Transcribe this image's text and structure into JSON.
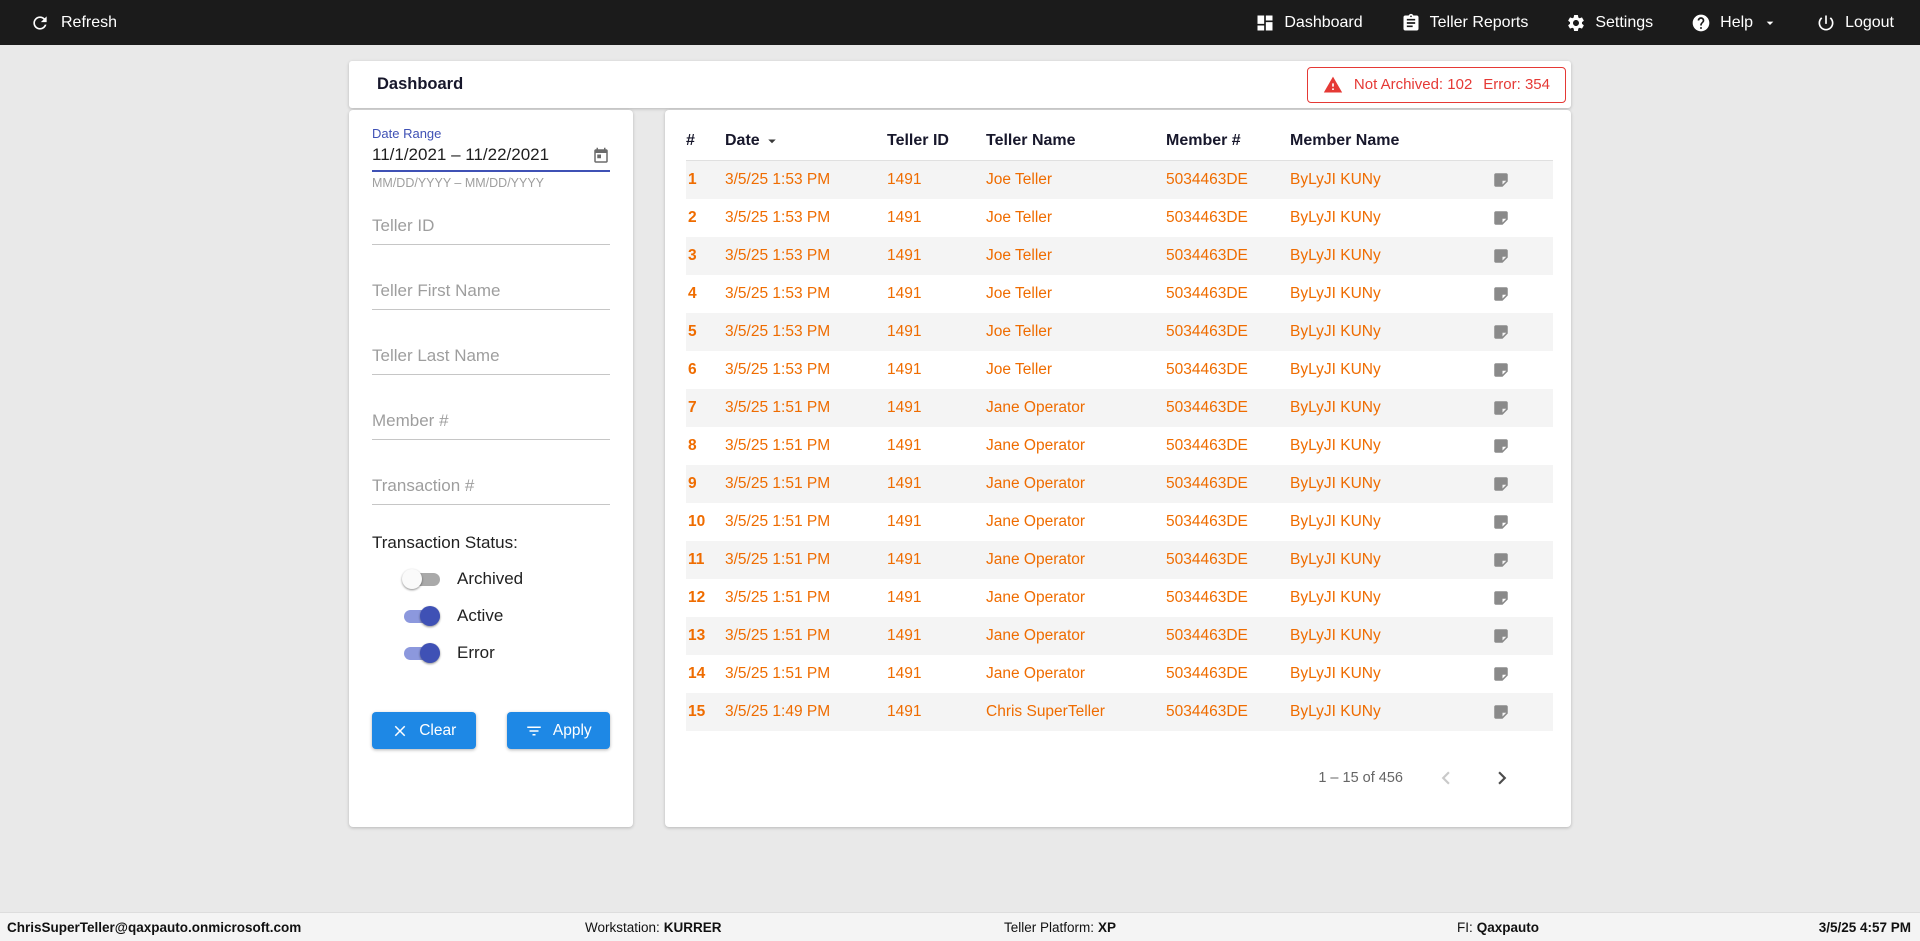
{
  "colors": {
    "accent_blue": "#1e88e5",
    "toggle_on": "#3f51b5",
    "row_text_orange": "#ef6c00",
    "alert_red": "#e53935",
    "topbar_bg": "#1b1b1b"
  },
  "topbar": {
    "refresh_label": "Refresh",
    "nav": [
      {
        "label": "Dashboard",
        "icon": "dashboard-icon"
      },
      {
        "label": "Teller Reports",
        "icon": "clipboard-icon"
      },
      {
        "label": "Settings",
        "icon": "gear-icon"
      },
      {
        "label": "Help",
        "icon": "help-icon"
      },
      {
        "label": "Logout",
        "icon": "power-icon"
      }
    ]
  },
  "header": {
    "title": "Dashboard",
    "alert": {
      "not_archived": "Not Archived: 102",
      "error": "Error: 354"
    }
  },
  "filters": {
    "date_range": {
      "label": "Date Range",
      "value": "11/1/2021 – 11/22/2021",
      "helper": "MM/DD/YYYY – MM/DD/YYYY"
    },
    "fields": [
      {
        "placeholder": "Teller ID"
      },
      {
        "placeholder": "Teller First Name"
      },
      {
        "placeholder": "Teller Last Name"
      },
      {
        "placeholder": "Member #"
      },
      {
        "placeholder": "Transaction #"
      }
    ],
    "status": {
      "label": "Transaction Status:",
      "toggles": [
        {
          "label": "Archived",
          "on": false
        },
        {
          "label": "Active",
          "on": true
        },
        {
          "label": "Error",
          "on": true
        }
      ]
    },
    "clear_label": "Clear",
    "apply_label": "Apply"
  },
  "table": {
    "columns": [
      "#",
      "Date",
      "Teller ID",
      "Teller Name",
      "Member #",
      "Member Name"
    ],
    "rows": [
      {
        "num": "1",
        "date": "3/5/25 1:53 PM",
        "teller_id": "1491",
        "teller_name": "Joe Teller",
        "member_num": "5034463DE",
        "member_name": "ByLyJI KUNy"
      },
      {
        "num": "2",
        "date": "3/5/25 1:53 PM",
        "teller_id": "1491",
        "teller_name": "Joe Teller",
        "member_num": "5034463DE",
        "member_name": "ByLyJI KUNy"
      },
      {
        "num": "3",
        "date": "3/5/25 1:53 PM",
        "teller_id": "1491",
        "teller_name": "Joe Teller",
        "member_num": "5034463DE",
        "member_name": "ByLyJI KUNy"
      },
      {
        "num": "4",
        "date": "3/5/25 1:53 PM",
        "teller_id": "1491",
        "teller_name": "Joe Teller",
        "member_num": "5034463DE",
        "member_name": "ByLyJI KUNy"
      },
      {
        "num": "5",
        "date": "3/5/25 1:53 PM",
        "teller_id": "1491",
        "teller_name": "Joe Teller",
        "member_num": "5034463DE",
        "member_name": "ByLyJI KUNy"
      },
      {
        "num": "6",
        "date": "3/5/25 1:53 PM",
        "teller_id": "1491",
        "teller_name": "Joe Teller",
        "member_num": "5034463DE",
        "member_name": "ByLyJI KUNy"
      },
      {
        "num": "7",
        "date": "3/5/25 1:51 PM",
        "teller_id": "1491",
        "teller_name": "Jane Operator",
        "member_num": "5034463DE",
        "member_name": "ByLyJI KUNy"
      },
      {
        "num": "8",
        "date": "3/5/25 1:51 PM",
        "teller_id": "1491",
        "teller_name": "Jane Operator",
        "member_num": "5034463DE",
        "member_name": "ByLyJI KUNy"
      },
      {
        "num": "9",
        "date": "3/5/25 1:51 PM",
        "teller_id": "1491",
        "teller_name": "Jane Operator",
        "member_num": "5034463DE",
        "member_name": "ByLyJI KUNy"
      },
      {
        "num": "10",
        "date": "3/5/25 1:51 PM",
        "teller_id": "1491",
        "teller_name": "Jane Operator",
        "member_num": "5034463DE",
        "member_name": "ByLyJI KUNy"
      },
      {
        "num": "11",
        "date": "3/5/25 1:51 PM",
        "teller_id": "1491",
        "teller_name": "Jane Operator",
        "member_num": "5034463DE",
        "member_name": "ByLyJI KUNy"
      },
      {
        "num": "12",
        "date": "3/5/25 1:51 PM",
        "teller_id": "1491",
        "teller_name": "Jane Operator",
        "member_num": "5034463DE",
        "member_name": "ByLyJI KUNy"
      },
      {
        "num": "13",
        "date": "3/5/25 1:51 PM",
        "teller_id": "1491",
        "teller_name": "Jane Operator",
        "member_num": "5034463DE",
        "member_name": "ByLyJI KUNy"
      },
      {
        "num": "14",
        "date": "3/5/25 1:51 PM",
        "teller_id": "1491",
        "teller_name": "Jane Operator",
        "member_num": "5034463DE",
        "member_name": "ByLyJI KUNy"
      },
      {
        "num": "15",
        "date": "3/5/25 1:49 PM",
        "teller_id": "1491",
        "teller_name": "Chris SuperTeller",
        "member_num": "5034463DE",
        "member_name": "ByLyJI KUNy"
      }
    ],
    "pagination": {
      "range": "1 – 15 of 456"
    }
  },
  "footer": {
    "user": "ChrisSuperTeller@qaxpauto.onmicrosoft.com",
    "workstation_label": "Workstation:",
    "workstation": "KURRER",
    "platform_label": "Teller Platform:",
    "platform": "XP",
    "fi_label": "FI:",
    "fi": "Qaxpauto",
    "time": "3/5/25 4:57 PM"
  }
}
